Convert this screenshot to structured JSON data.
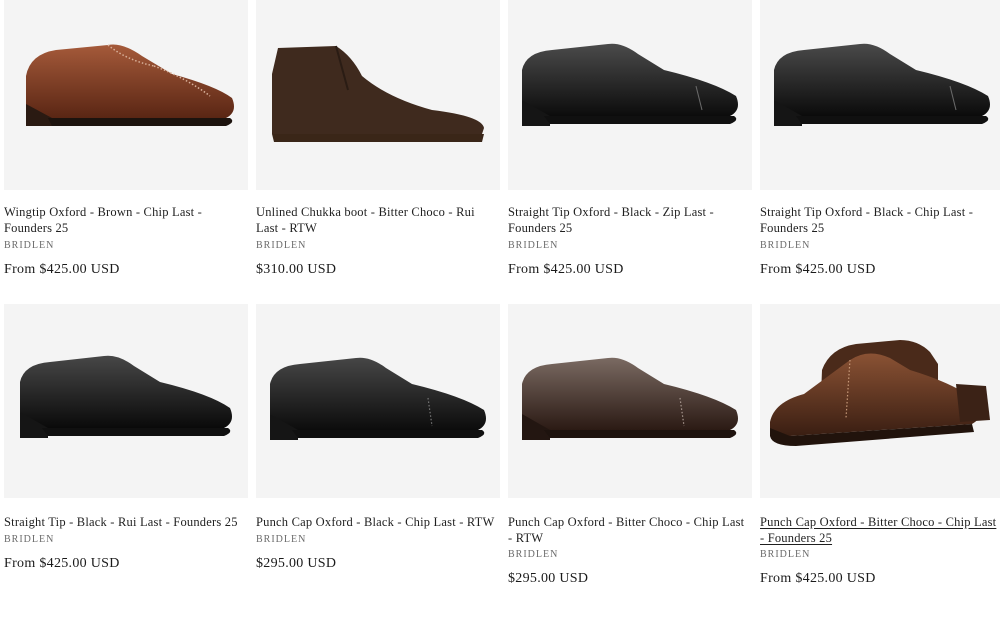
{
  "products": [
    {
      "title": "Wingtip Oxford - Brown - Chip Last - Founders 25",
      "vendor": "BRIDLEN",
      "price": "From $425.00 USD",
      "image_icon": "brown-wingtip-oxford-shoe",
      "color": "#7a3a22"
    },
    {
      "title": "Unlined Chukka boot - Bitter Choco - Rui Last - RTW",
      "vendor": "BRIDLEN",
      "price": "$310.00 USD",
      "image_icon": "brown-suede-chukka-boot",
      "color": "#3f2a1e"
    },
    {
      "title": "Straight Tip Oxford - Black - Zip Last - Founders 25",
      "vendor": "BRIDLEN",
      "price": "From $425.00 USD",
      "image_icon": "black-oxford-shoe",
      "color": "#151515"
    },
    {
      "title": "Straight Tip Oxford - Black - Chip Last - Founders 25",
      "vendor": "BRIDLEN",
      "price": "From $425.00 USD",
      "image_icon": "black-oxford-shoe",
      "color": "#141414"
    },
    {
      "title": "Straight Tip - Black - Rui Last - Founders 25",
      "vendor": "BRIDLEN",
      "price": "From $425.00 USD",
      "image_icon": "black-oxford-shoe",
      "color": "#121212"
    },
    {
      "title": "Punch Cap Oxford - Black - Chip Last - RTW",
      "vendor": "BRIDLEN",
      "price": "$295.00 USD",
      "image_icon": "black-punch-cap-oxford-shoe",
      "color": "#171717"
    },
    {
      "title": "Punch Cap Oxford - Bitter Choco - Chip Last - RTW",
      "vendor": "BRIDLEN",
      "price": "$295.00 USD",
      "image_icon": "dark-brown-punch-cap-oxford-shoe",
      "color": "#3b2620"
    },
    {
      "title": "Punch Cap Oxford - Bitter Choco - Chip Last - Founders 25",
      "vendor": "BRIDLEN",
      "price": "From $425.00 USD",
      "image_icon": "dark-brown-punch-cap-oxford-pair",
      "color": "#4a2a1a"
    }
  ]
}
